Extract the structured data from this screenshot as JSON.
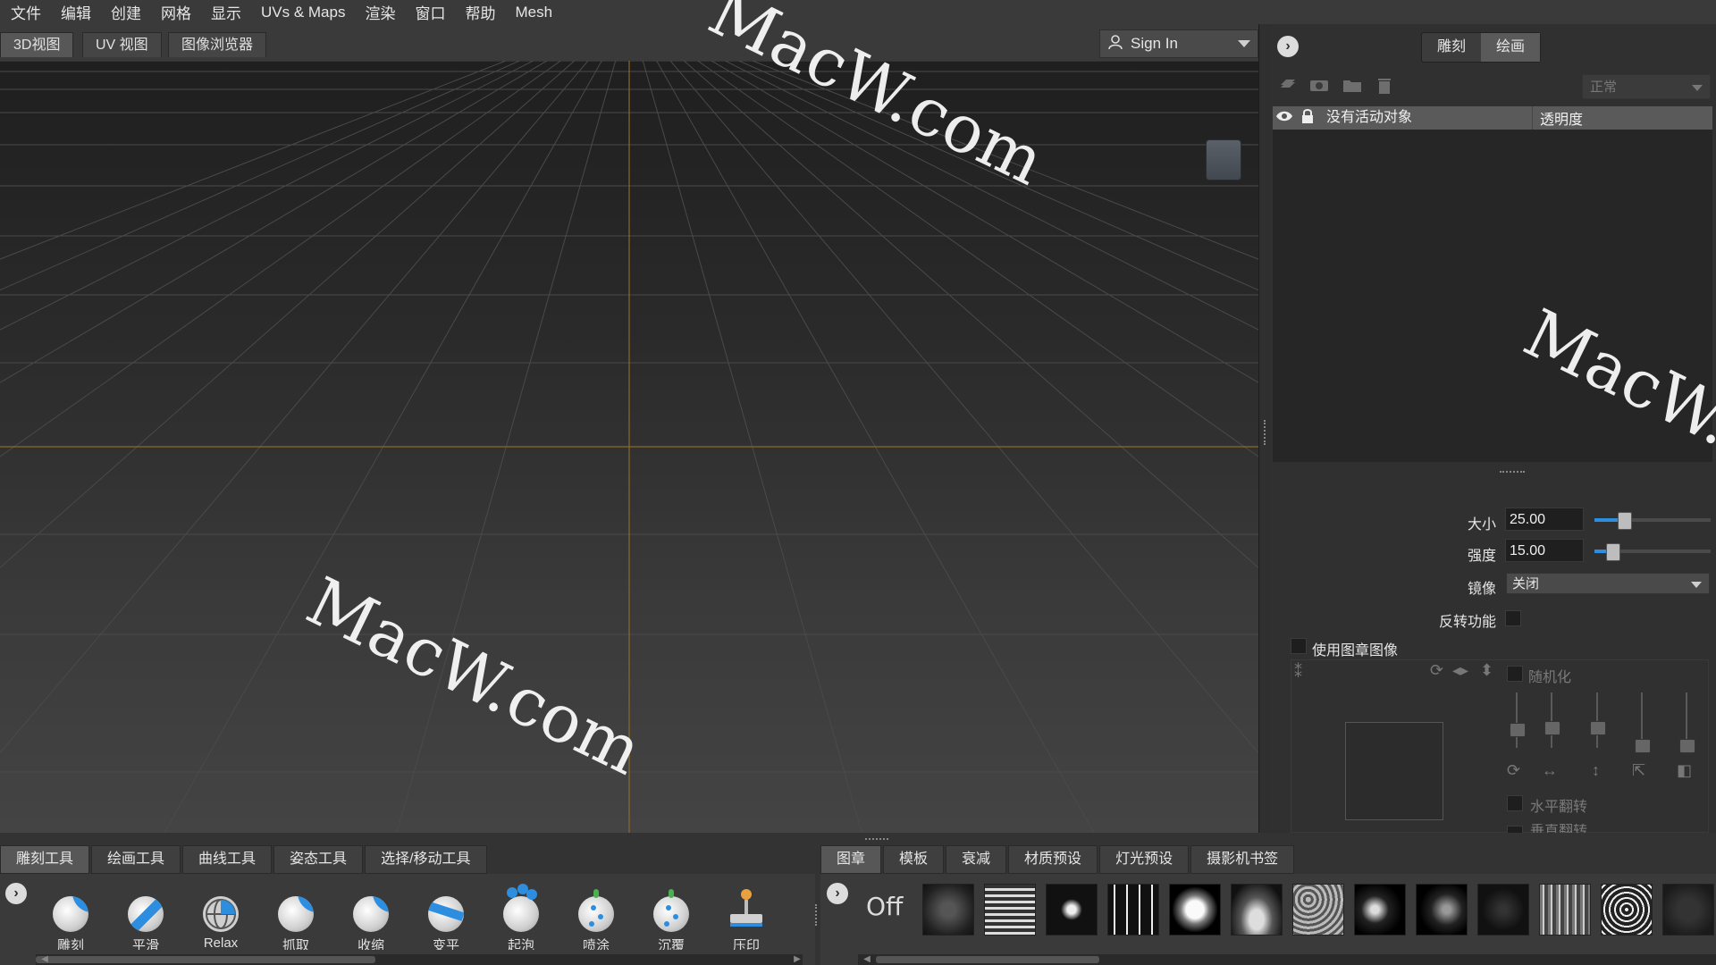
{
  "menu": [
    "文件",
    "编辑",
    "创建",
    "网格",
    "显示",
    "UVs & Maps",
    "渲染",
    "窗口",
    "帮助",
    "Mesh"
  ],
  "view_tabs": [
    "3D视图",
    "UV 视图",
    "图像浏览器"
  ],
  "active_view_tab": "3D视图",
  "sign_in": {
    "label": "Sign In",
    "icon": "user-icon"
  },
  "right_panel": {
    "mode_tabs": [
      "雕刻",
      "绘画"
    ],
    "active_mode": "绘画",
    "layer_icons": [
      "layers-icon",
      "camera-icon",
      "folder-icon",
      "trash-icon"
    ],
    "blend_mode": "正常",
    "layer_header": {
      "name": "没有活动对象",
      "opacity": "透明度"
    },
    "properties": {
      "size_label": "大小",
      "size_value": "25.00",
      "size_fraction": 0.25,
      "strength_label": "强度",
      "strength_value": "15.00",
      "strength_fraction": 0.15,
      "mirror_label": "镜像",
      "mirror_value": "关闭",
      "invert_label": "反转功能",
      "use_stamp_label": "使用图章图像",
      "randomize_label": "随机化",
      "flip_h_label": "水平翻转",
      "flip_v_label": "垂直翻转"
    }
  },
  "bottom_left_tabs": [
    "雕刻工具",
    "绘画工具",
    "曲线工具",
    "姿态工具",
    "选择/移动工具"
  ],
  "active_bottom_left_tab": "雕刻工具",
  "tools": [
    "雕刻",
    "平滑",
    "Relax",
    "抓取",
    "收缩",
    "变平",
    "起泡",
    "喷涂",
    "沉覆",
    "压印"
  ],
  "bottom_right_tabs": [
    "图章",
    "模板",
    "衰减",
    "材质预设",
    "灯光预设",
    "摄影机书签"
  ],
  "active_bottom_right_tab": "图章",
  "stamp_off_label": "Off",
  "watermark": "MacW.com"
}
